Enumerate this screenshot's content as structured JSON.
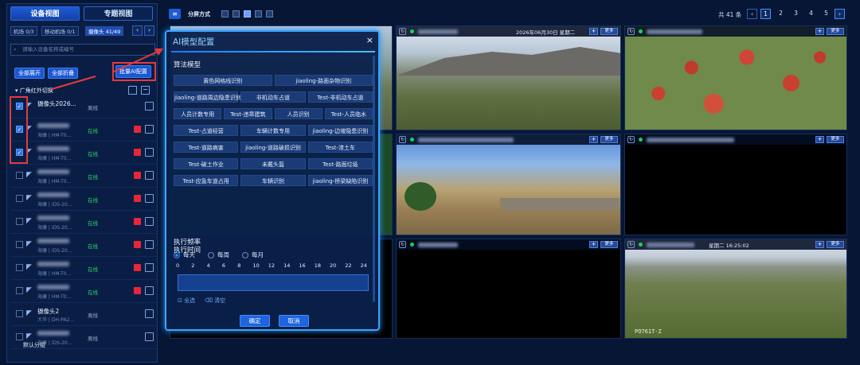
{
  "left": {
    "tabs": [
      "设备视图",
      "专题视图"
    ],
    "filters": [
      "机场 0/3",
      "移动机场 0/1",
      "摄像头 41/49"
    ],
    "search_placeholder": "请输入设备名称或编号",
    "expand_all": "全部展开",
    "collapse_all": "全部折叠",
    "batch_ai": "批量AI配置",
    "group_name": "广角红外切换",
    "rows": [
      {
        "name": "摄像头2026...",
        "sub": "",
        "status": "离线",
        "checked": true
      },
      {
        "name": "",
        "sub": "海康 | HM-T0...",
        "status": "在线",
        "checked": true
      },
      {
        "name": "",
        "sub": "海康 | HM-T0...",
        "status": "在线",
        "checked": true
      },
      {
        "name": "",
        "sub": "海康 | HM-T0...",
        "status": "在线",
        "checked": false
      },
      {
        "name": "",
        "sub": "海康 | iDS-20...",
        "status": "在线",
        "checked": false
      },
      {
        "name": "",
        "sub": "海康 | iDS-20...",
        "status": "在线",
        "checked": false
      },
      {
        "name": "",
        "sub": "海康 | iDS-20...",
        "status": "在线",
        "checked": false
      },
      {
        "name": "",
        "sub": "海康 | HM-T0...",
        "status": "在线",
        "checked": false
      },
      {
        "name": "",
        "sub": "海康 | HM-T0...",
        "status": "在线",
        "checked": false
      },
      {
        "name": "摄像头2",
        "sub": "大华 | DH-PA2...",
        "status": "离线",
        "checked": false
      },
      {
        "name": "",
        "sub": "海康 | iDS-20...",
        "status": "离线",
        "checked": false
      }
    ],
    "footer_group": "默认分组"
  },
  "top": {
    "split_label": "分屏方式",
    "total": "共 41 条",
    "pages": [
      "1",
      "2",
      "3",
      "4",
      "5"
    ],
    "prev": "‹",
    "next": "›"
  },
  "tiles": {
    "more": "更多",
    "plus": "+",
    "ts1": "2026年06月30日  星期二",
    "ts2": "星期二  16:25:02",
    "cam_label": "PO761T-Z"
  },
  "modal": {
    "title": "AI模型配置",
    "close": "×",
    "algo_title": "算法模型",
    "algorithms": [
      [
        "黄色网格线识别",
        "jiaoling-路面杂物识别"
      ],
      [
        "jiaoling-道路周边隐患识别",
        "非机动车占道",
        "Test-非机动车占道"
      ],
      [
        "人员计数专用",
        "Test-违章建筑",
        "人员识别",
        "Test-人员临水"
      ],
      [
        "Test-占道经营",
        "车辆计数专用",
        "jiaoling-边坡隐患识别"
      ],
      [
        "Test-道路病害",
        "jiaoling-道路破损识别",
        "Test-渣土车"
      ],
      [
        "Test-破土作业",
        "未戴头盔",
        "Test-路面垃圾"
      ],
      [
        "Test-应急车道占用",
        "车辆识别",
        "jiaoling-桥梁缺陷识别"
      ]
    ],
    "freq_title": "执行频率",
    "freq": [
      "每天",
      "每周",
      "每月"
    ],
    "freq_selected": "每天",
    "time_title": "执行时间",
    "hours": [
      "0",
      "2",
      "4",
      "6",
      "8",
      "10",
      "12",
      "14",
      "16",
      "18",
      "20",
      "22",
      "24"
    ],
    "select_all": "全选",
    "clear": "清空",
    "confirm": "确定",
    "cancel": "取消"
  }
}
